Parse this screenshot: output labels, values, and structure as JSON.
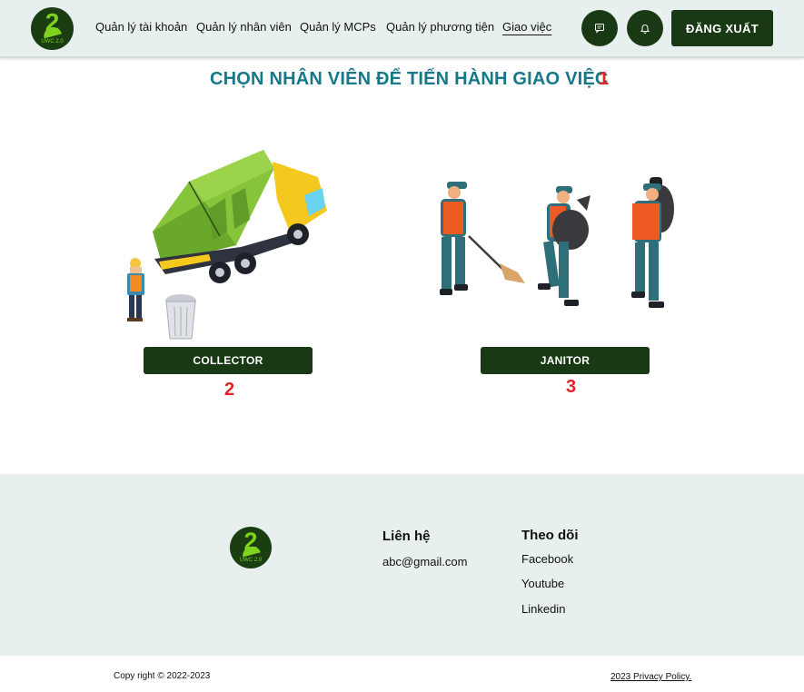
{
  "header": {
    "logo_text": "UWC 2.0",
    "nav": [
      {
        "label": "Quản lý tài khoản"
      },
      {
        "label": "Quản lý nhân viên"
      },
      {
        "label": "Quản lý MCPs"
      },
      {
        "label": "Quản lý phương tiện"
      },
      {
        "label": "Giao việc"
      }
    ],
    "active_nav": "Giao việc",
    "icons": [
      "chat-icon",
      "bell-icon"
    ],
    "logout_label": "ĐĂNG XUẤT"
  },
  "main": {
    "title": "CHỌN NHÂN VIÊN ĐỂ TIẾN HÀNH GIAO VIỆC",
    "markers": [
      "1",
      "2",
      "3"
    ],
    "roles": [
      {
        "label": "COLLECTOR"
      },
      {
        "label": "JANITOR"
      }
    ]
  },
  "footer": {
    "logo_text": "UWC 2.0",
    "contact_heading": "Liên hệ",
    "contact_email": "abc@gmail.com",
    "follow_heading": "Theo dõi",
    "social": [
      "Facebook",
      "Youtube",
      "Linkedin"
    ],
    "copyright": "Copy right © 2022-2023",
    "privacy": "2023 Privacy Policy."
  },
  "colors": {
    "brand_dark": "#183913",
    "title": "#17788a",
    "marker": "#e02424",
    "header_bg": "#e7f0ee"
  }
}
